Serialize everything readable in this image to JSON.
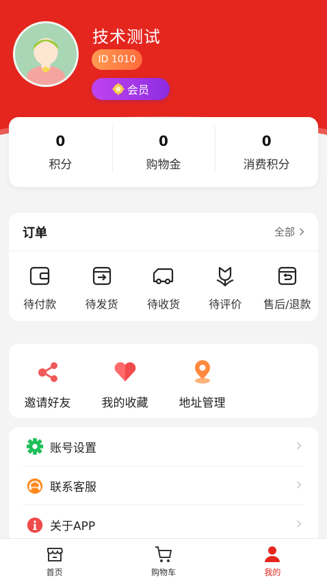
{
  "profile": {
    "username": "技术测试",
    "id_label": "ID 1010",
    "member_label": "会员"
  },
  "stats": [
    {
      "value": "0",
      "label": "积分"
    },
    {
      "value": "0",
      "label": "购物金"
    },
    {
      "value": "0",
      "label": "消费积分"
    }
  ],
  "orders": {
    "title": "订单",
    "all_label": "全部",
    "items": [
      {
        "label": "待付款",
        "icon": "wallet-icon"
      },
      {
        "label": "待发货",
        "icon": "box-out-icon"
      },
      {
        "label": "待收货",
        "icon": "truck-icon"
      },
      {
        "label": "待评价",
        "icon": "flower-icon"
      },
      {
        "label": "售后/退款",
        "icon": "return-icon"
      }
    ]
  },
  "tools": [
    {
      "label": "邀请好友",
      "icon": "share-icon"
    },
    {
      "label": "我的收藏",
      "icon": "heart-icon"
    },
    {
      "label": "地址管理",
      "icon": "location-icon"
    }
  ],
  "settings": [
    {
      "label": "账号设置",
      "icon": "gear-icon"
    },
    {
      "label": "联系客服",
      "icon": "headset-icon"
    },
    {
      "label": "关于APP",
      "icon": "info-icon"
    }
  ],
  "tabbar": [
    {
      "label": "首页",
      "icon": "store-icon"
    },
    {
      "label": "购物车",
      "icon": "cart-icon"
    },
    {
      "label": "我的",
      "icon": "user-icon",
      "active": true
    }
  ],
  "colors": {
    "brand_red": "#e4261f",
    "member_purple": "#9b33e6",
    "id_orange": "#ff7f45",
    "settings_green": "#1fbf5a",
    "service_orange": "#ff8a1f",
    "about_red": "#f04a4a"
  }
}
